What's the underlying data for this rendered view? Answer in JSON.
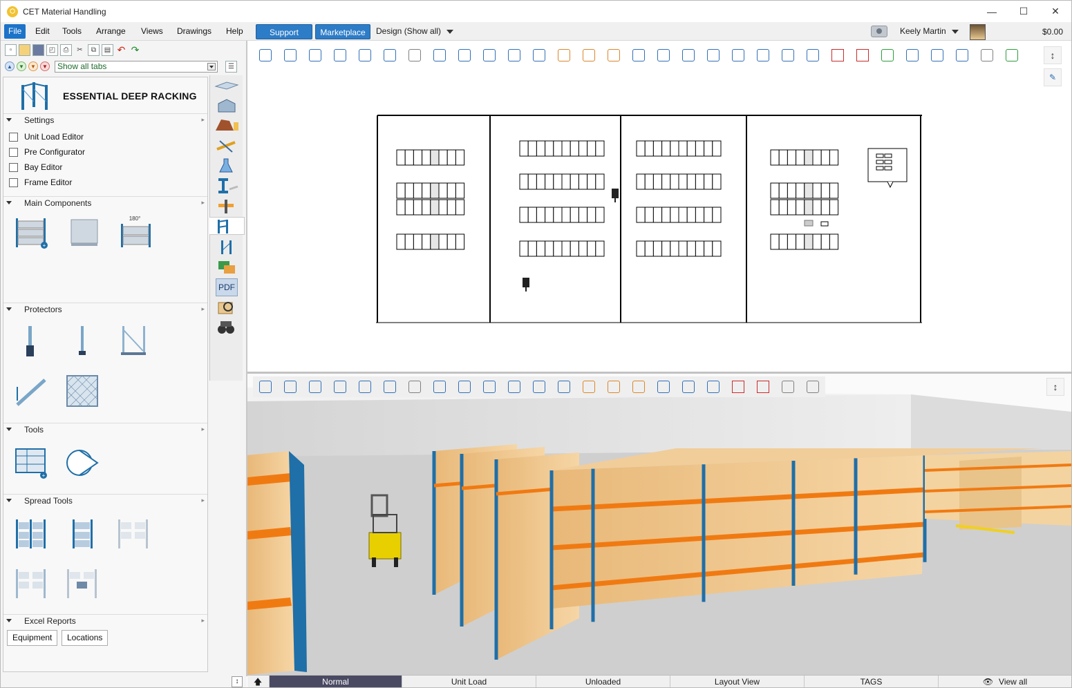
{
  "window": {
    "title": "CET Material Handling",
    "controls": {
      "minimize": "—",
      "maximize": "☐",
      "close": "✕"
    }
  },
  "menubar": {
    "items": [
      "File",
      "Edit",
      "Tools",
      "Arrange",
      "Views",
      "Drawings",
      "Help"
    ],
    "support": "Support",
    "marketplace": "Marketplace",
    "design_dropdown": "Design (Show all)",
    "user_name": "Keely Martin",
    "balance": "$0.00"
  },
  "quick_access": {
    "tabs_filter": "Show all tabs"
  },
  "library": {
    "title": "ESSENTIAL DEEP RACKING",
    "sections": {
      "settings": "Settings",
      "main_components": "Main Components",
      "protectors": "Protectors",
      "tools": "Tools",
      "spread_tools": "Spread Tools",
      "excel_reports": "Excel Reports"
    },
    "settings_items": [
      "Unit Load Editor",
      "Pre Configurator",
      "Bay Editor",
      "Frame Editor"
    ],
    "rotate_badge": "180°",
    "excel_buttons": [
      "Equipment",
      "Locations"
    ],
    "side_tab_pdf": "PDF"
  },
  "statusbar": {
    "cells": [
      "Normal",
      "Unit Load",
      "Unloaded",
      "Layout View",
      "TAGS",
      "View all"
    ]
  },
  "colors": {
    "accent_blue": "#1c73c9",
    "rack_blue": "#1f6fa8",
    "beam_orange": "#f07a12",
    "box_tan": "#f3c98e",
    "status_active": "#4a4a63"
  },
  "icons": {
    "toolbar_2d": [
      "2d-view-icon",
      "3d-iso-icon",
      "zoom-extents-icon",
      "zoom-in-icon",
      "zoom-out-icon",
      "zoom-window-icon",
      "pan-icon",
      "zoom-selection-icon",
      "camera-icon",
      "frame-icon",
      "render-icon",
      "rotate-icon",
      "flip-icon",
      "align-icon",
      "snap-icon",
      "select-window-icon",
      "lasso-icon",
      "annotate-icon",
      "dimension-icon",
      "connect-icon",
      "resize-icon",
      "measure-icon",
      "layers-icon",
      "delete-icon",
      "cut-icon",
      "replace-icon",
      "swap-icon",
      "line-icon",
      "arrow-line-icon",
      "ruler-icon",
      "expand-icon"
    ],
    "toolbar_3d": [
      "2d-view-icon",
      "3d-iso-icon",
      "zoom-extents-icon",
      "zoom-in-icon",
      "zoom-out-icon",
      "zoom-window-icon",
      "pan-icon",
      "orbit-icon",
      "fit-icon",
      "walk-icon",
      "camera-icon",
      "film-icon",
      "render-icon",
      "flip-icon",
      "align-icon",
      "snap-icon",
      "select-window-icon",
      "annotate-icon",
      "resize-icon",
      "delete-icon",
      "cut-icon",
      "ruler-icon",
      "link-icon"
    ]
  }
}
